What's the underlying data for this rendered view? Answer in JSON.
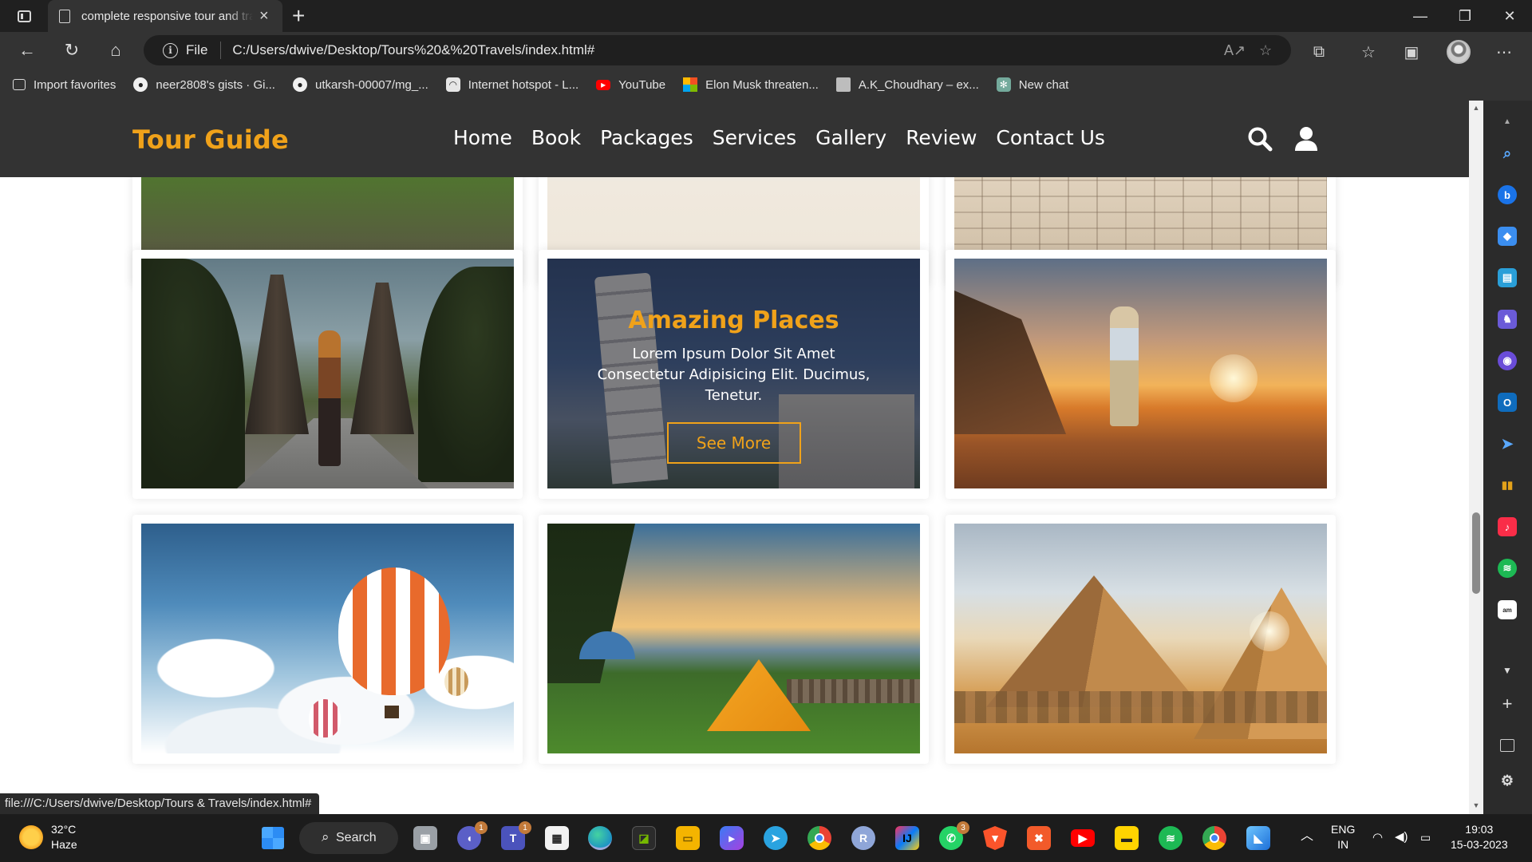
{
  "browser": {
    "tab_title": "complete responsive tour and tra",
    "file_label": "File",
    "url": "C:/Users/dwive/Desktop/Tours%20&%20Travels/index.html#",
    "window_controls": [
      "minimize",
      "restore",
      "close"
    ],
    "favorites": [
      {
        "label": "Import favorites",
        "icon": "import-icon"
      },
      {
        "label": "neer2808's gists · Gi...",
        "icon": "github-icon"
      },
      {
        "label": "utkarsh-00007/mg_...",
        "icon": "github-icon"
      },
      {
        "label": "Internet hotspot - L...",
        "icon": "wifi-icon"
      },
      {
        "label": "YouTube",
        "icon": "youtube-icon"
      },
      {
        "label": "Elon Musk threaten...",
        "icon": "microsoft-icon"
      },
      {
        "label": "A.K_Choudhary – ex...",
        "icon": "image-icon"
      },
      {
        "label": "New chat",
        "icon": "chatgpt-icon"
      }
    ],
    "status_url": "file:///C:/Users/dwive/Desktop/Tours & Travels/index.html#"
  },
  "site": {
    "logo": "Tour Guide",
    "nav": [
      "Home",
      "Book",
      "Packages",
      "Services",
      "Gallery",
      "Review",
      "Contact Us"
    ],
    "gallery": {
      "overlay_title": "Amazing Places",
      "overlay_text": "Lorem Ipsum Dolor Sit Amet Consectetur Adipisicing Elit. Ducimus, Tenetur.",
      "overlay_button": "See More"
    }
  },
  "taskbar": {
    "weather_temp": "32°C",
    "weather_desc": "Haze",
    "search_label": "Search",
    "lang_top": "ENG",
    "lang_bottom": "IN",
    "time": "19:03",
    "date": "15-03-2023",
    "badges": {
      "teams": "1",
      "teams2": "1",
      "whatsapp": "3"
    }
  },
  "colors": {
    "accent": "#f0a21a",
    "header_bg": "#333333",
    "chrome_bg": "#202020"
  }
}
